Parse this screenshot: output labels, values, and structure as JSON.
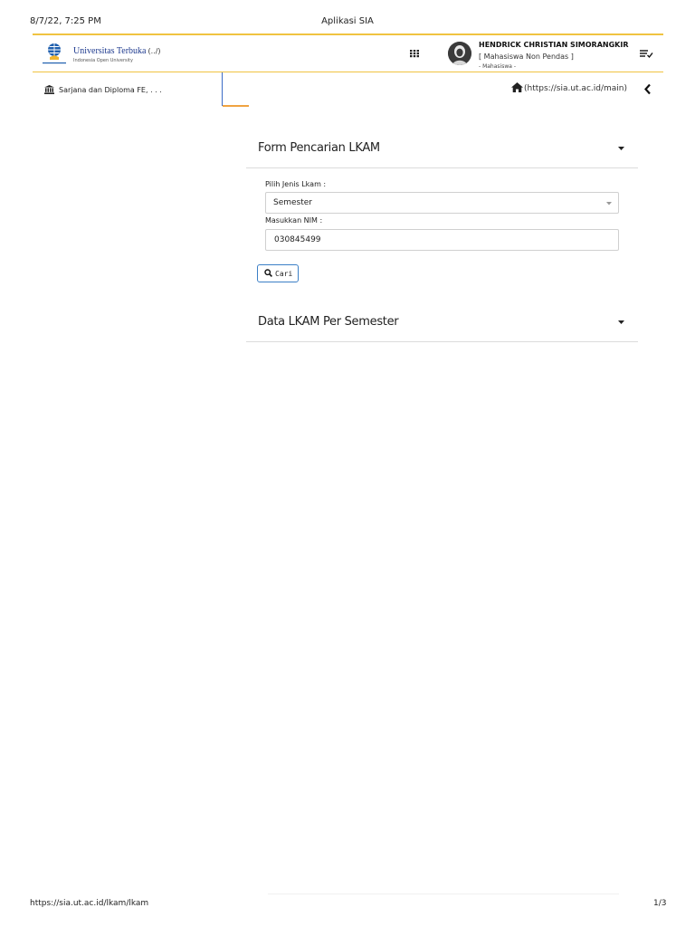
{
  "print": {
    "datetime": "8/7/22, 7:25 PM",
    "title": "Aplikasi SIA",
    "url": "https://sia.ut.ac.id/lkam/lkam",
    "page": "1/3"
  },
  "header": {
    "brand_name": "Universitas Terbuka",
    "brand_suffix": "(../)",
    "brand_tagline": "Indonesia Open University",
    "user_name": "HENDRICK CHRISTIAN SIMORANGKIR",
    "user_role": "[ Mahasiswa Non Pendas ]",
    "user_group": "- Mahasiswa -",
    "icons": {
      "apps": "grid-icon",
      "menu": "menu-check-icon",
      "avatar": "user-avatar"
    },
    "accent_color": "#f0c341"
  },
  "breadcrumb": {
    "left_label": "Sarjana dan Diploma FE, . . .",
    "home_link": "(https://sia.ut.ac.id/main)",
    "icons": {
      "left": "bank-icon",
      "home": "home-icon",
      "back": "chevron-left-icon"
    }
  },
  "form_section": {
    "title": "Form Pencarian LKAM",
    "type_label": "Pilih Jenis Lkam :",
    "type_value": "Semester",
    "nim_label": "Masukkan NIM :",
    "nim_value": "030845499",
    "search_button": "Cari",
    "button_color": "#3b7fc6"
  },
  "data_section": {
    "title": "Data LKAM Per Semester"
  }
}
